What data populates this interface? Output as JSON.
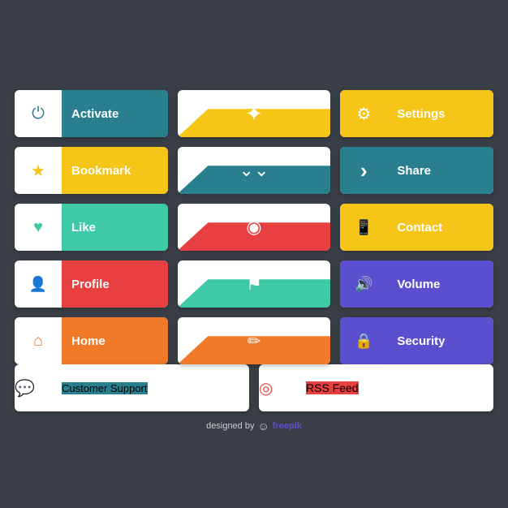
{
  "buttons": {
    "activate": {
      "label": "Activate",
      "icon": "⏻",
      "iconColor": "#2a7f8f",
      "labelBg": "#2a7f8f"
    },
    "bookmark": {
      "label": "Bookmark",
      "icon": "★",
      "iconColor": "#f5c518",
      "labelBg": "#f5c518"
    },
    "like": {
      "label": "Like",
      "icon": "♥",
      "iconColor": "#3ec9a7",
      "labelBg": "#3ec9a7"
    },
    "profile": {
      "label": "Profile",
      "icon": "👤",
      "iconColor": "#e84040",
      "labelBg": "#e84040"
    },
    "home": {
      "label": "Home",
      "icon": "⌂",
      "iconColor": "#f07a28",
      "labelBg": "#f07a28"
    },
    "settings": {
      "label": "Settings",
      "icon": "⚙",
      "iconColor": "#f5c518",
      "labelBg": "#f5c518"
    },
    "share": {
      "label": "Share",
      "icon": "›",
      "iconColor": "#2a7f8f",
      "labelBg": "#2a7f8f"
    },
    "contact": {
      "label": "Contact",
      "icon": "▣",
      "iconColor": "#f5c518",
      "labelBg": "#f5c518"
    },
    "volume": {
      "label": "Volume",
      "icon": "🔊",
      "iconColor": "#5b4fcf",
      "labelBg": "#5b4fcf"
    },
    "security": {
      "label": "Security",
      "icon": "🔒",
      "iconColor": "#5b4fcf",
      "labelBg": "#5b4fcf"
    },
    "customerSupport": {
      "label": "Customer Support",
      "icon": "💬",
      "iconColor": "#2a7f8f",
      "labelBg": "#2a7f8f"
    },
    "rssFeed": {
      "label": "RSS Feed",
      "icon": "◎",
      "iconColor": "#e84040",
      "labelBg": "#e84040"
    }
  },
  "midCards": {
    "star": {
      "iconColor": "#f5c518",
      "bgColor": "#f5c518",
      "icon": "✦"
    },
    "chevrons": {
      "iconColor": "#2a7f8f",
      "bgColor": "#2a7f8f",
      "icon": "⌄⌄"
    },
    "eye": {
      "iconColor": "#e84040",
      "bgColor": "#e84040",
      "icon": "◉"
    },
    "flag": {
      "iconColor": "#3ec9a7",
      "bgColor": "#3ec9a7",
      "icon": "⚑"
    },
    "pencil": {
      "iconColor": "#f07a28",
      "bgColor": "#f07a28",
      "icon": "✏"
    }
  },
  "footer": {
    "text": "designed by",
    "brand": "freepik"
  }
}
